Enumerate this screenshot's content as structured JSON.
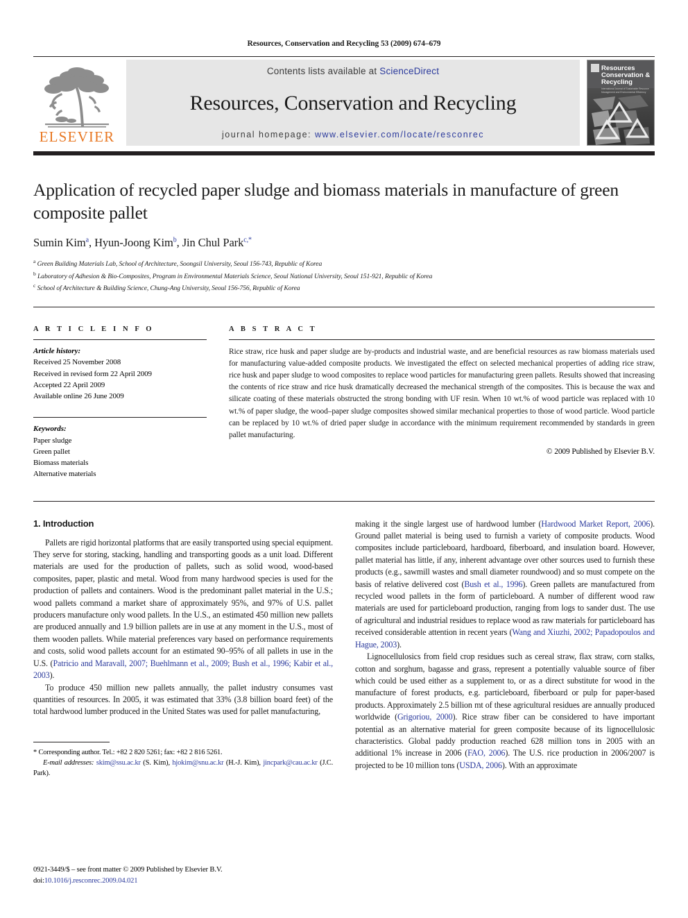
{
  "running_head": "Resources, Conservation and Recycling 53 (2009) 674–679",
  "masthead": {
    "publisher_name": "ELSEVIER",
    "contents_prefix": "Contents lists available at ",
    "contents_link": "ScienceDirect",
    "journal_title": "Resources, Conservation and Recycling",
    "homepage_prefix": "journal homepage: ",
    "homepage_url": "www.elsevier.com/locate/resconrec",
    "cover_title_line1": "Resources",
    "cover_title_line2": "Conservation &",
    "cover_title_line3": "Recycling",
    "cover_subtitle": "International Journal of Sustainable Resource Management and Environmental Efficiency"
  },
  "article": {
    "title": "Application of recycled paper sludge and biomass materials in manufacture of green composite pallet",
    "authors": [
      {
        "name": "Sumin Kim",
        "sup": "a"
      },
      {
        "name": "Hyun-Joong Kim",
        "sup": "b"
      },
      {
        "name": "Jin Chul Park",
        "sup": "c,*"
      }
    ],
    "authors_line": "Sumin Kim",
    "affiliations": [
      {
        "marker": "a",
        "text": "Green Building Materials Lab, School of Architecture, Soongsil University, Seoul 156-743, Republic of Korea"
      },
      {
        "marker": "b",
        "text": "Laboratory of Adhesion & Bio-Composites, Program in Environmental Materials Science, Seoul National University, Seoul 151-921, Republic of Korea"
      },
      {
        "marker": "c",
        "text": "School of Architecture & Building Science, Chung-Ang University, Seoul 156-756, Republic of Korea"
      }
    ]
  },
  "article_info": {
    "heading": "A R T I C L E   I N F O",
    "history_label": "Article history:",
    "history": [
      "Received 25 November 2008",
      "Received in revised form 22 April 2009",
      "Accepted 22 April 2009",
      "Available online 26 June 2009"
    ],
    "keywords_label": "Keywords:",
    "keywords": [
      "Paper sludge",
      "Green pallet",
      "Biomass materials",
      "Alternative materials"
    ]
  },
  "abstract": {
    "heading": "A B S T R A C T",
    "text": "Rice straw, rice husk and paper sludge are by-products and industrial waste, and are beneficial resources as raw biomass materials used for manufacturing value-added composite products. We investigated the effect on selected mechanical properties of adding rice straw, rice husk and paper sludge to wood composites to replace wood particles for manufacturing green pallets. Results showed that increasing the contents of rice straw and rice husk dramatically decreased the mechanical strength of the composites. This is because the wax and silicate coating of these materials obstructed the strong bonding with UF resin. When 10 wt.% of wood particle was replaced with 10 wt.% of paper sludge, the wood–paper sludge composites showed similar mechanical properties to those of wood particle. Wood particle can be replaced by 10 wt.% of dried paper sludge in accordance with the minimum requirement recommended by standards in green pallet manufacturing.",
    "copyright": "© 2009 Published by Elsevier B.V."
  },
  "body": {
    "section_heading": "1. Introduction",
    "left_paragraphs": [
      "Pallets are rigid horizontal platforms that are easily transported using special equipment. They serve for storing, stacking, handling and transporting goods as a unit load. Different materials are used for the production of pallets, such as solid wood, wood-based composites, paper, plastic and metal. Wood from many hardwood species is used for the production of pallets and containers. Wood is the predominant pallet material in the U.S.; wood pallets command a market share of approximately 95%, and 97% of U.S. pallet producers manufacture only wood pallets. In the U.S., an estimated 450 million new pallets are produced annually and 1.9 billion pallets are in use at any moment in the U.S., most of them wooden pallets. While material preferences vary based on performance requirements and costs, solid wood pallets account for an estimated 90–95% of all pallets in use in the U.S. (",
      "Patricio and Maravall, 2007; Buehlmann et al., 2009; Bush et al., 1996; Kabir et al., 2003",
      ").",
      "To produce 450 million new pallets annually, the pallet industry consumes vast quantities of resources. In 2005, it was estimated that 33% (3.8 billion board feet) of the total hardwood lumber produced in the United States was used for pallet manufacturing,"
    ],
    "right_paragraphs": [
      "making it the single largest use of hardwood lumber (",
      "Hardwood Market Report, 2006",
      "). Ground pallet material is being used to furnish a variety of composite products. Wood composites include particleboard, hardboard, fiberboard, and insulation board. However, pallet material has little, if any, inherent advantage over other sources used to furnish these products (e.g., sawmill wastes and small diameter roundwood) and so must compete on the basis of relative delivered cost (",
      "Bush et al., 1996",
      "). Green pallets are manufactured from recycled wood pallets in the form of particleboard. A number of different wood raw materials are used for particleboard production, ranging from logs to sander dust. The use of agricultural and industrial residues to replace wood as raw materials for particleboard has received considerable attention in recent years (",
      "Wang and Xiuzhi, 2002; Papadopoulos and Hague, 2003",
      ").",
      "Lignocellulosics from field crop residues such as cereal straw, flax straw, corn stalks, cotton and sorghum, bagasse and grass, represent a potentially valuable source of fiber which could be used either as a supplement to, or as a direct substitute for wood in the manufacture of forest products, e.g. particleboard, fiberboard or pulp for paper-based products. Approximately 2.5 billion mt of these agricultural residues are annually produced worldwide (",
      "Grigoriou, 2000",
      "). Rice straw fiber can be considered to have important potential as an alternative material for green composite because of its lignocellulosic characteristics. Global paddy production reached 628 million tons in 2005 with an additional 1% increase in 2006 (",
      "FAO, 2006",
      "). The U.S. rice production in 2006/2007 is projected to be 10 million tons (",
      "USDA, 2006",
      "). With an approximate"
    ]
  },
  "footnote": {
    "corresponding": "* Corresponding author. Tel.: +82 2 820 5261; fax: +82 2 816 5261.",
    "email_label": "E-mail addresses:",
    "email1": "skim@ssu.ac.kr",
    "email1_who": "(S. Kim),",
    "email2": "hjokim@snu.ac.kr",
    "email2_who": "(H.-J. Kim),",
    "email3": "jincpark@cau.ac.kr",
    "email3_who": "(J.C. Park)."
  },
  "issn": {
    "line1": "0921-3449/$ – see front matter © 2009 Published by Elsevier B.V.",
    "doi_label": "doi:",
    "doi_value": "10.1016/j.resconrec.2009.04.021"
  },
  "colors": {
    "link": "#2b3a9c",
    "elsevier_orange": "#E87722",
    "band_gray": "#e6e6e6",
    "rule_black": "#231f20"
  }
}
